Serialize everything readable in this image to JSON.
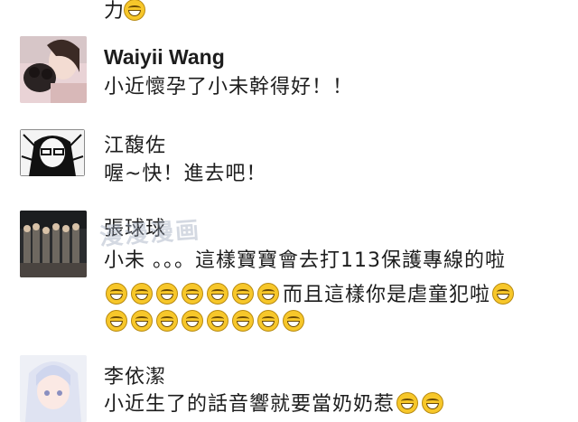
{
  "top_fragment": {
    "text": "力"
  },
  "comments": [
    {
      "name": "Waiyii Wang",
      "text": "小近懷孕了小未幹得好！！"
    },
    {
      "name": "江馥佐",
      "text": "喔~快！進去吧！"
    },
    {
      "name": "張球球",
      "line1": "小未 。。。這樣寶寶會去打113保護專線的啦",
      "line2": "而且這樣你是虐童犯啦"
    },
    {
      "name": "李依潔",
      "text": "小近生了的話音響就要當奶奶惹"
    }
  ],
  "watermark": {
    "text": "漫漫漫画"
  },
  "colors": {
    "emoji_fill": "#f7c72a",
    "text": "#1d1d1d"
  }
}
